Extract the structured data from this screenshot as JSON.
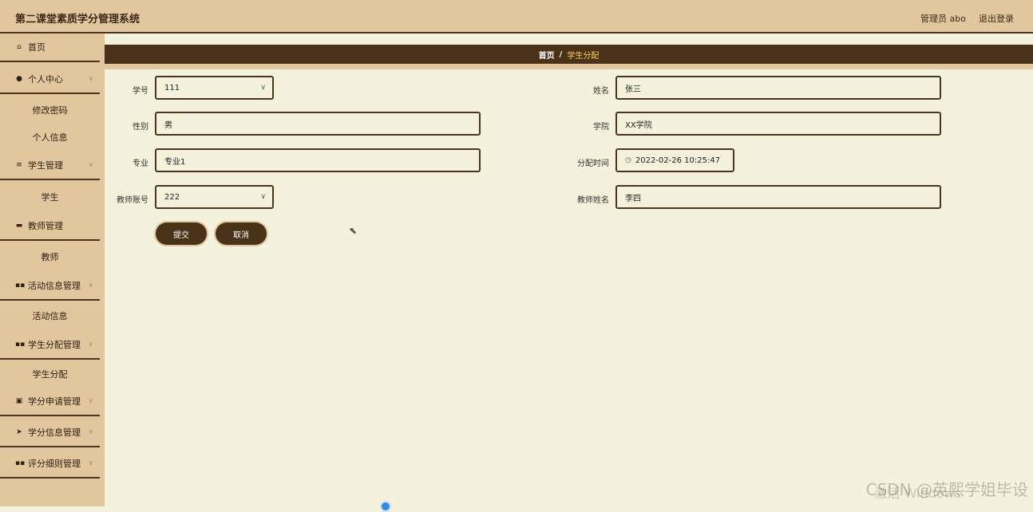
{
  "header": {
    "title": "第二课堂素质学分管理系统",
    "user": "管理员 abo",
    "logout": "退出登录"
  },
  "sidebar": {
    "home": "首页",
    "personal": "个人中心",
    "change_password": "修改密码",
    "personal_info": "个人信息",
    "student_mgmt": "学生管理",
    "student": "学生",
    "teacher_mgmt": "教师管理",
    "teacher": "教师",
    "activity_mgmt": "活动信息管理",
    "activity_info": "活动信息",
    "assign_mgmt": "学生分配管理",
    "assign": "学生分配",
    "credit_apply_mgmt": "学分申请管理",
    "credit_info_mgmt": "学分信息管理",
    "rules_mgmt": "评分细则管理"
  },
  "breadcrumb": {
    "home": "首页",
    "sep": "/",
    "current": "学生分配"
  },
  "form": {
    "student_no_label": "学号",
    "student_no": "111",
    "name_label": "姓名",
    "name": "张三",
    "gender_label": "性别",
    "gender": "男",
    "college_label": "学院",
    "college": "XX学院",
    "major_label": "专业",
    "major": "专业1",
    "assign_time_label": "分配时间",
    "assign_time": "2022-02-26 10:25:47",
    "teacher_account_label": "教师账号",
    "teacher_account": "222",
    "teacher_name_label": "教师姓名",
    "teacher_name": "李四",
    "submit": "提交",
    "cancel": "取消"
  },
  "watermark": {
    "csdn": "CSDN @英熙学姐毕设",
    "windows": "激活 Windows"
  }
}
